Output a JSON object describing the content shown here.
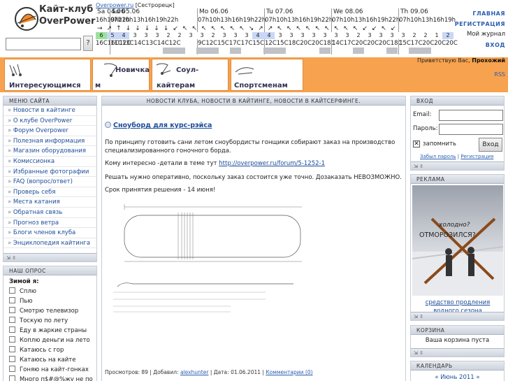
{
  "site": {
    "title": "Кайт-клуб",
    "subtitle": "OverPower",
    "search_button": "?"
  },
  "forecast": {
    "source_link": "Overpower.ru",
    "source_place": "[Сестрорецк]",
    "days": [
      {
        "label": "Sa 04.06",
        "hours": "16h19h22h"
      },
      {
        "label": "Su 05.06",
        "hours": "07h10h13h16h19h22h"
      },
      {
        "label": "Mo 06.06",
        "hours": "07h10h13h16h19h22h"
      },
      {
        "label": "Tu 07.06",
        "hours": "07h10h13h16h19h22h"
      },
      {
        "label": "We 08.06",
        "hours": "07h10h13h16h19h22h"
      },
      {
        "label": "Th 09.06",
        "hours": "07h10h13h16h19h"
      }
    ],
    "arrows": [
      "→",
      "↗",
      "↑",
      "↓",
      "↓",
      "↓",
      "↓",
      "↓",
      "↙",
      "↖",
      "↖",
      "↖",
      "↖",
      "↖",
      "↖",
      "↖",
      "↘",
      "↗",
      "↗",
      "↖",
      "↖",
      "↖",
      "↖",
      "↖",
      "↖",
      "↖",
      "↖",
      "↖",
      "↙",
      "↙",
      "↖",
      "↙"
    ],
    "wind": [
      "6",
      "5",
      "4",
      "3",
      "3",
      "3",
      "2",
      "2",
      "3",
      "3",
      "2",
      "3",
      "3",
      "3",
      "4",
      "4",
      "3",
      "3",
      "3",
      "3",
      "3",
      "3",
      "3",
      "2",
      "3",
      "3",
      "3",
      "3",
      "2",
      "2",
      "1",
      "2"
    ],
    "temps": [
      "16C16C12C",
      "11C13C14C13C14C12C",
      "9C12C15C17C17C15C",
      "12C15C18C20C20C18C",
      "14C17C20C20C20C18C",
      "15C17C20C20C20C"
    ],
    "colors": {
      "wind_green": "#9be39b",
      "wind_blue": "#c9d7f7",
      "cloud_grey": "#bfc2c7"
    }
  },
  "topnav": {
    "links": [
      "Главная",
      "Регистрация"
    ],
    "journal": "Мой журнал",
    "login": "Вход"
  },
  "banner": {
    "tabs": [
      {
        "name": "tab-interesting",
        "label": "Интересующимся"
      },
      {
        "name": "tab-beginners",
        "label1": "Новичка",
        "label2": "м"
      },
      {
        "name": "tab-soul",
        "label1": "Соул-",
        "label2": "кайтерам"
      },
      {
        "name": "tab-athletes",
        "label": "Спортсменам"
      }
    ],
    "greeting_prefix": "Приветствую Вас,",
    "greeting_user": "Прохожий",
    "rss": "RSS",
    "accent": "#f7a24e"
  },
  "left": {
    "menu_title": "Меню сайта",
    "menu_items": [
      "Новости в кайтинге",
      "О клубе OverPower",
      "Форум Overpower",
      "Полезная информация",
      "Магазин оборудования",
      "Комиссионка",
      "Избранные фотографии",
      "FAQ (вопрос/ответ)",
      "Проверь себя",
      "Места катания",
      "Обратная связь",
      "Прогноз ветра",
      "Блоги членов клуба",
      "Энциклопедия кайтинга"
    ],
    "poll_title": "Наш опрос",
    "poll_question": "Зимой я:",
    "poll_options": [
      "Сплю",
      "Пью",
      "Смотрю телевизор",
      "Тоскую по лету",
      "Еду в жаркие страны",
      "Коплю деньги на лето",
      "Катаюсь с гор",
      "Катаюсь на кайте",
      "Гоняю на кайт-гонках",
      "Много п$#@%жу не по"
    ]
  },
  "center": {
    "section_title": "Новости клуба, новости в кайтинге, новости в кайтсерфинге.",
    "article": {
      "title": "Сноуборд для курс-рэйса",
      "p1": "По принципу готовить сани летом сноубордисты гонщики собирают заказ на производство специализированного гоночного борда.",
      "p2_prefix": "Кому интересно -детали в теме тут",
      "p2_link": "http://overpower.ru/forum/5-1252-1",
      "p3": "Решать нужно оперативно, поскольку заказ состоится уже точно. Дозаказать НЕВОЗМОЖНО.",
      "p4": "Срок принятия решения - 14 июня!",
      "meta_views": "Просмотров: 89",
      "meta_added_label": "Добавил:",
      "meta_author": "alexhunter",
      "meta_date": "Дата: 01.06.2011",
      "meta_comments": "Комментарии (0)"
    }
  },
  "right": {
    "login_title": "Вход",
    "email_label": "Email:",
    "password_label": "Пароль:",
    "remember_label": "запомнить",
    "login_button": "Вход",
    "forgot_link": "Забыл пароль",
    "register_link": "Регистрация",
    "ads_title": "Реклама",
    "ad_line1": "холодно?",
    "ad_line2": "ОТМОРОЗИЛСЯ?",
    "ad_caption": "средство продления водного сезона",
    "cart_title": "Корзина",
    "cart_text": "Ваша корзина пуста",
    "calendar_title": "Календарь",
    "calendar_month": "«  Июнь 2011  »"
  }
}
